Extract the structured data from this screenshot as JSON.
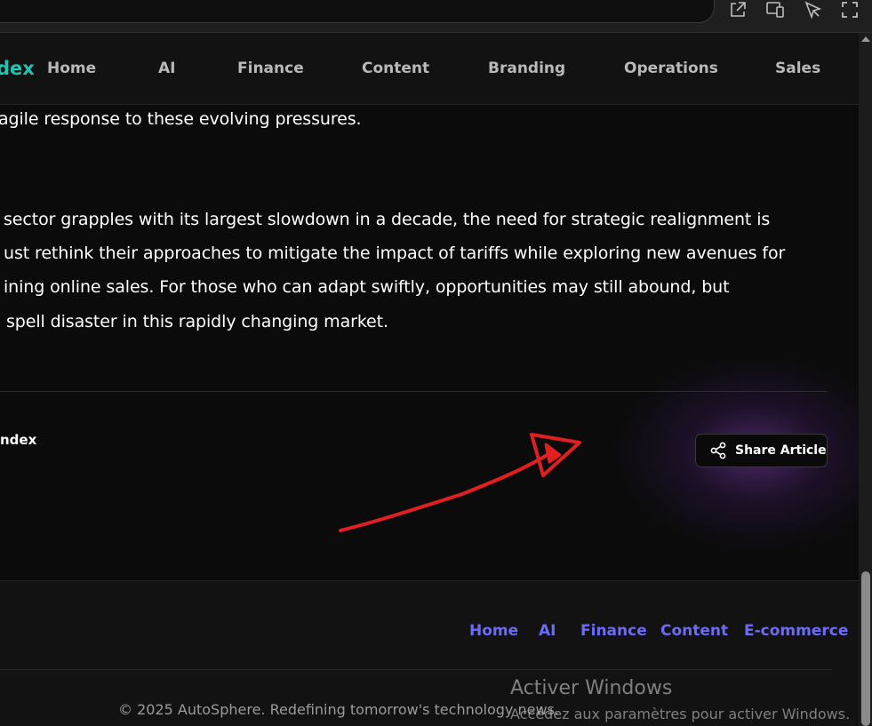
{
  "browser": {
    "icons": [
      "external-link-icon",
      "device-toolbar-icon",
      "inspect-cursor-icon",
      "fullscreen-icon"
    ]
  },
  "nav": {
    "brand": "dex",
    "links": [
      "Home",
      "AI",
      "Finance",
      "Content",
      "Branding",
      "Operations",
      "Sales"
    ]
  },
  "article": {
    "lines": [
      "agile response to these evolving pressures.",
      "sector grapples with its largest slowdown in a decade, the need for strategic realignment is",
      "ust rethink their approaches to mitigate the impact of tariffs while exploring new avenues for",
      "ining online sales. For those who can adapt swiftly, opportunities may still abound, but",
      "spell disaster in this rapidly changing market."
    ],
    "author": "ndex",
    "share_label": "Share Article"
  },
  "footer": {
    "links": [
      "Home",
      "AI",
      "Finance",
      "Content",
      "E-commerce"
    ],
    "copyright": "© 2025 AutoSphere. Redefining tomorrow's technology news."
  },
  "watermark": {
    "title": "Activer Windows",
    "subtitle": "Accédez aux paramètres pour activer Windows."
  },
  "colors": {
    "brand": "#22c3b0",
    "footer_link": "#6a6cf7",
    "annotation": "#e02020",
    "glow": "#7a3cb0"
  }
}
